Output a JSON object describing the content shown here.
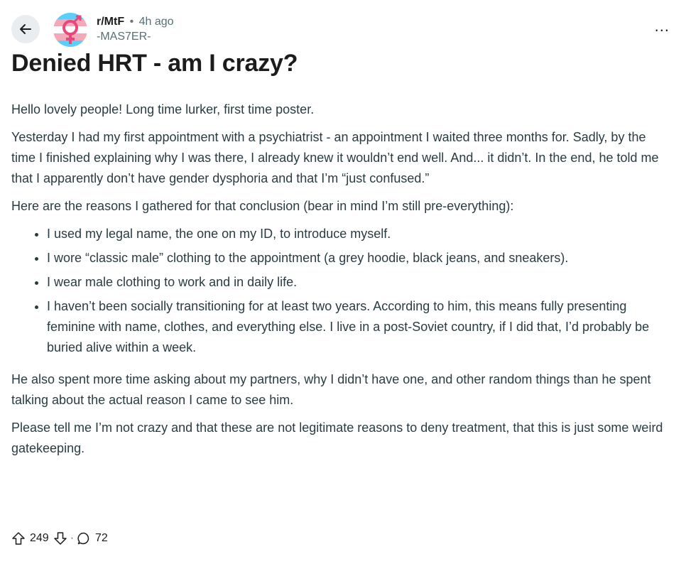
{
  "header": {
    "subreddit": "r/MtF",
    "time_ago": "4h ago",
    "separator": "•",
    "username": "-MAS7ER-",
    "more_label": "..."
  },
  "post": {
    "title": "Denied HRT - am I crazy?",
    "paragraphs_before": [
      "Hello lovely people! Long time lurker, first time poster.",
      "Yesterday I had my first appointment with a psychiatrist - an appointment I waited three months for. Sadly, by the time I finished explaining why I was there, I already knew it wouldn’t end well. And... it didn’t. In the end, he told me that I apparently don’t have gender dysphoria and that I’m “just confused.”",
      "Here are the reasons I gathered for that conclusion (bear in mind I’m still pre-everything):"
    ],
    "bullets": [
      "I used my legal name, the one on my ID, to introduce myself.",
      "I wore “classic male” clothing to the appointment (a grey hoodie, black jeans, and sneakers).",
      "I wear male clothing to work and in daily life.",
      "I haven’t been socially transitioning for at least two years. According to him, this means fully presenting feminine with name, clothes, and everything else. I live in a post-Soviet country, if I did that, I’d probably be buried alive within a week."
    ],
    "paragraphs_after": [
      "He also spent more time asking about my partners, why I didn’t have one, and other random things than he spent talking about the actual reason I came to see him.",
      "Please tell me I’m not crazy and that these are not legitimate reasons to deny treatment, that this is just some weird gatekeeping."
    ]
  },
  "actions": {
    "upvotes": "249",
    "comments": "72",
    "separator": "·"
  },
  "icons": {
    "back": "arrow-left-icon",
    "upvote": "upvote-arrow-icon",
    "downvote": "downvote-arrow-icon",
    "comment": "comment-bubble-icon",
    "more": "more-options-icon"
  },
  "colors": {
    "trans_blue": "#5bcefa",
    "trans_pink": "#f5a9b8",
    "symbol_pink": "#e8477a",
    "muted": "#576f76"
  }
}
